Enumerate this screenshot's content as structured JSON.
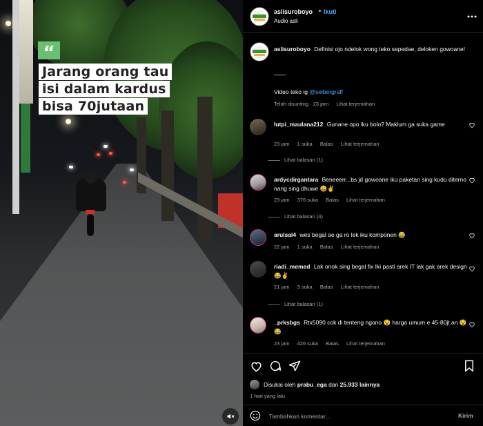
{
  "video": {
    "caption_lines": [
      "Jarang orang tau",
      "isi dalam kardus",
      "bisa 70jutaan"
    ],
    "quote_mark": "“",
    "mute_icon": "speaker-muted-icon"
  },
  "header": {
    "username": "aslisuroboyo",
    "dot": "•",
    "follow_label": "Ikuti",
    "audio_label": "Audio asli",
    "more_icon": "more-horizontal-icon"
  },
  "caption": {
    "username": "aslisuroboyo",
    "text": "Definisi ojo ndelok wong teko sepedae, deloken gowoane!",
    "separator": "——",
    "credit_prefix": "Video teko ig",
    "credit_handle": "@seibergraff",
    "meta": "Telah disunting · 23 jam",
    "translate": "Lihat terjemahan"
  },
  "comments": [
    {
      "username": "lutpi_maulana212",
      "text": "Gunane opo iku bolo? Maklum ga suka game",
      "time": "23 jam",
      "likes": "1 suka",
      "reply": "Balas",
      "translate": "Lihat terjemahan",
      "replies_label": "Lihat balasan (1)"
    },
    {
      "username": "ardycdirgantara",
      "text": "Beneeerr...bs jd gowoane iku paketan sing kudu diterno nang sing dhuwe 😄✌️",
      "time": "23 jam",
      "likes": "376 suka",
      "reply": "Balas",
      "translate": "Lihat terjemahan",
      "replies_label": "Lihat balasan (4)"
    },
    {
      "username": "arulsal4",
      "text": "wes begal ae ga ro lek iku komponen 😂",
      "time": "22 jam",
      "likes": "1 suka",
      "reply": "Balas",
      "translate": "Lihat terjemahan"
    },
    {
      "username": "riadi_memed",
      "text": "Lak onok sing begal fix Iki pasti arek IT lak gak arek design 😂✌️",
      "time": "21 jam",
      "likes": "3 suka",
      "reply": "Balas",
      "translate": "Lihat terjemahan",
      "replies_label": "Lihat balasan (1)"
    },
    {
      "username": "_prksbgs",
      "text": "Rtx5090 cok di tenteng ngono 😵 harga umum e 45-80jt an 😵😂",
      "time": "23 jam",
      "likes": "426 suka",
      "reply": "Balas",
      "translate": "Lihat terjemahan"
    }
  ],
  "actions": {
    "liked_prefix": "Disukai oleh",
    "liked_user": "prabu_ega",
    "liked_and": "dan",
    "liked_count": "25.933 lainnya",
    "time_ago": "1 hari yang lalu",
    "comment_placeholder": "Tambahkan komentar...",
    "post_label": "Kirim"
  },
  "colors": {
    "accent_link": "#4aa8ff",
    "story_ring": "#c13584",
    "caption_badge": "#68c070"
  }
}
